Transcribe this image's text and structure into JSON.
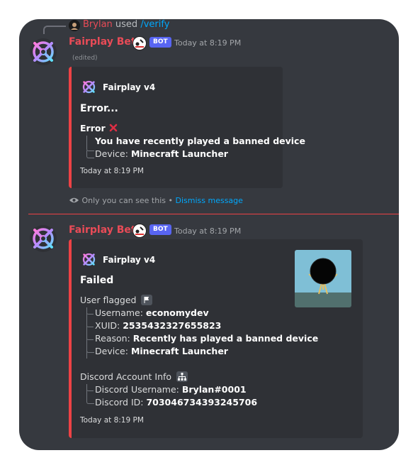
{
  "reply": {
    "user": "Brylan",
    "used": "used",
    "command": "/verify"
  },
  "messages": [
    {
      "username": "Fairplay Beta",
      "badge": "BOT",
      "timestamp": "Today at 8:19 PM",
      "edited": "(edited)",
      "embed": {
        "author": "Fairplay v4",
        "title": "Error...",
        "field_name": "Error",
        "lines": [
          {
            "label": "",
            "value": "You have recently played a banned device"
          },
          {
            "label": "Device: ",
            "value": "Minecraft Launcher"
          }
        ],
        "footer": "Today at 8:19 PM"
      },
      "ephemeral": {
        "text": "Only you can see this",
        "sep": "•",
        "dismiss": "Dismiss message"
      }
    },
    {
      "username": "Fairplay Beta",
      "badge": "BOT",
      "timestamp": "Today at 8:19 PM",
      "embed": {
        "author": "Fairplay v4",
        "title": "Failed",
        "section1": "User flagged",
        "lines1": [
          {
            "label": "Username: ",
            "value": "economydev"
          },
          {
            "label": "XUID: ",
            "value": "2535432327655823"
          },
          {
            "label": "Reason: ",
            "value": "Recently has played a banned device"
          },
          {
            "label": "Device: ",
            "value": "Minecraft Launcher"
          }
        ],
        "section2": "Discord Account Info",
        "lines2": [
          {
            "label": "Discord Username: ",
            "value": "Brylan#0001"
          },
          {
            "label": "Discord ID: ",
            "value": "703046734393245706"
          }
        ],
        "footer": "Today at 8:19 PM"
      }
    }
  ],
  "colors": {
    "background": "#36393f",
    "embed": "#2f3136",
    "accent": "#ed4245",
    "username": "#e94b57",
    "link": "#00a8fc",
    "badge": "#5865f2"
  },
  "icons": [
    "fairplay-logo-icon",
    "bot-emoji-icon",
    "eye-icon",
    "red-x-icon",
    "flag-icon",
    "hierarchy-icon"
  ]
}
